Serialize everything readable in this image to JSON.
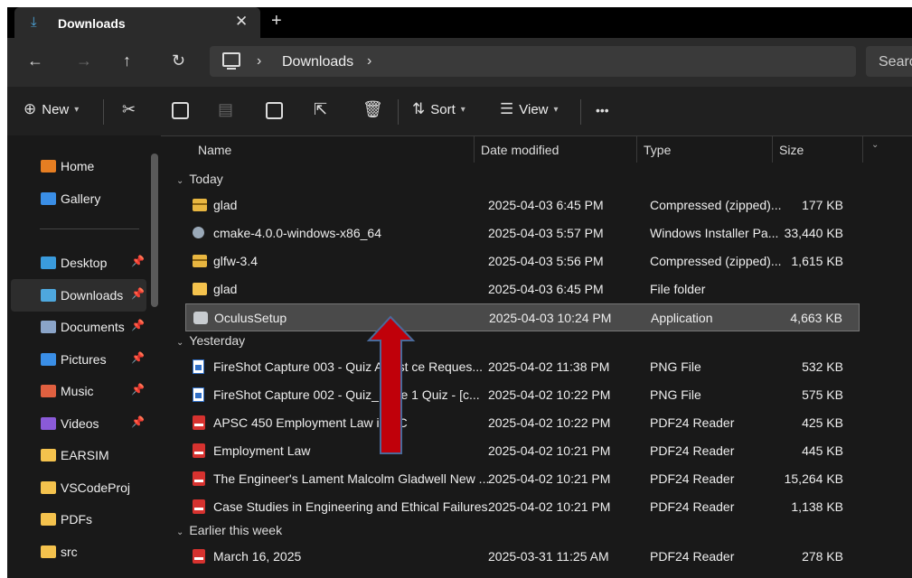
{
  "tab": {
    "title": "Downloads",
    "close": "✕",
    "new": "+"
  },
  "address": {
    "crumbs": [
      "Downloads"
    ],
    "search_placeholder": "Search"
  },
  "toolbar": {
    "new_label": "New",
    "sort_label": "Sort",
    "view_label": "View",
    "more": "•••"
  },
  "sidebar": {
    "items": [
      {
        "label": "Home",
        "icon": "home-icon",
        "color": "#e67e22"
      },
      {
        "label": "Gallery",
        "icon": "gallery-icon",
        "color": "#3a8ee6"
      },
      {
        "label": "Desktop",
        "icon": "desktop-icon",
        "color": "#3a9bdc",
        "pinned": true
      },
      {
        "label": "Downloads",
        "icon": "downloads-icon",
        "color": "#4ea8de",
        "pinned": true,
        "selected": true
      },
      {
        "label": "Documents",
        "icon": "documents-icon",
        "color": "#8aa4c8",
        "pinned": true
      },
      {
        "label": "Pictures",
        "icon": "pictures-icon",
        "color": "#3a8ee6",
        "pinned": true
      },
      {
        "label": "Music",
        "icon": "music-icon",
        "color": "#e06040",
        "pinned": true
      },
      {
        "label": "Videos",
        "icon": "videos-icon",
        "color": "#8a5ad8",
        "pinned": true
      },
      {
        "label": "EARSIM",
        "icon": "folder-icon",
        "color": "#f4c24d"
      },
      {
        "label": "VSCodeProj",
        "icon": "folder-icon",
        "color": "#f4c24d"
      },
      {
        "label": "PDFs",
        "icon": "folder-icon",
        "color": "#f4c24d"
      },
      {
        "label": "src",
        "icon": "folder-icon",
        "color": "#f4c24d"
      }
    ]
  },
  "columns": {
    "name": "Name",
    "date": "Date modified",
    "type": "Type",
    "size": "Size"
  },
  "groups": [
    {
      "label": "Today",
      "files": [
        {
          "name": "glad",
          "date": "2025-04-03 6:45 PM",
          "type": "Compressed (zipped)...",
          "size": "177 KB",
          "icon": "zip"
        },
        {
          "name": "cmake-4.0.0-windows-x86_64",
          "date": "2025-04-03 5:57 PM",
          "type": "Windows Installer Pa...",
          "size": "33,440 KB",
          "icon": "msi"
        },
        {
          "name": "glfw-3.4",
          "date": "2025-04-03 5:56 PM",
          "type": "Compressed (zipped)...",
          "size": "1,615 KB",
          "icon": "zip"
        },
        {
          "name": "glad",
          "date": "2025-04-03 6:45 PM",
          "type": "File folder",
          "size": "",
          "icon": "folder"
        },
        {
          "name": "OculusSetup",
          "date": "2025-04-03 10:24 PM",
          "type": "Application",
          "size": "4,663 KB",
          "icon": "app",
          "selected": true
        }
      ]
    },
    {
      "label": "Yesterday",
      "files": [
        {
          "name": "FireShot Capture 003 - Quiz Assist  ce Reques...",
          "date": "2025-04-02 11:38 PM",
          "type": "PNG File",
          "size": "532 KB",
          "icon": "png"
        },
        {
          "name": "FireShot Capture 002 - Quiz_ Wee  1 Quiz - [c...",
          "date": "2025-04-02 10:22 PM",
          "type": "PNG File",
          "size": "575 KB",
          "icon": "png"
        },
        {
          "name": "APSC 450 Employment Law in BC",
          "date": "2025-04-02 10:22 PM",
          "type": "PDF24 Reader",
          "size": "425 KB",
          "icon": "pdf"
        },
        {
          "name": "Employment Law",
          "date": "2025-04-02 10:21 PM",
          "type": "PDF24 Reader",
          "size": "445 KB",
          "icon": "pdf"
        },
        {
          "name": "The Engineer's Lament Malcolm Gladwell New ...",
          "date": "2025-04-02 10:21 PM",
          "type": "PDF24 Reader",
          "size": "15,264 KB",
          "icon": "pdf"
        },
        {
          "name": "Case Studies in Engineering and Ethical Failures",
          "date": "2025-04-02 10:21 PM",
          "type": "PDF24 Reader",
          "size": "1,138 KB",
          "icon": "pdf"
        }
      ]
    },
    {
      "label": "Earlier this week",
      "files": [
        {
          "name": "March 16, 2025",
          "date": "2025-03-31 11:25 AM",
          "type": "PDF24 Reader",
          "size": "278 KB",
          "icon": "pdf"
        }
      ]
    }
  ],
  "annotation": {
    "arrow_color": "#c0000a",
    "arrow_outline": "#4a6a9a"
  }
}
